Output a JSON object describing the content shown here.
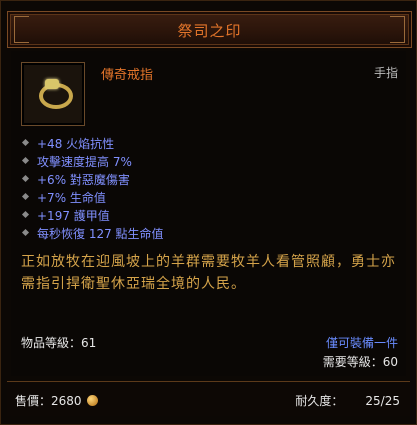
{
  "title": "祭司之印",
  "item": {
    "name": "傳奇戒指",
    "type": "手指",
    "icon": "gold-ring-icon"
  },
  "stats": [
    "+48 火焰抗性",
    "攻擊速度提高 7%",
    "+6% 對惡魔傷害",
    "+7% 生命值",
    "+197 護甲值",
    "每秒恢復 127 點生命值"
  ],
  "lore": "正如放牧在迎風坡上的羊群需要牧羊人看管照顧，勇士亦需指引捍衛聖休亞瑞全境的人民。",
  "item_level": "物品等級：61",
  "class_requirement": "僅可裝備一件",
  "level_requirement": "需要等級：60",
  "sell_price": {
    "label": "售價：",
    "value": "2680"
  },
  "durability": {
    "label": "耐久度：",
    "value": "25/25"
  },
  "colors": {
    "title": "#e2742a",
    "magic_stat": "#8090ff",
    "lore": "#d4a34a"
  }
}
